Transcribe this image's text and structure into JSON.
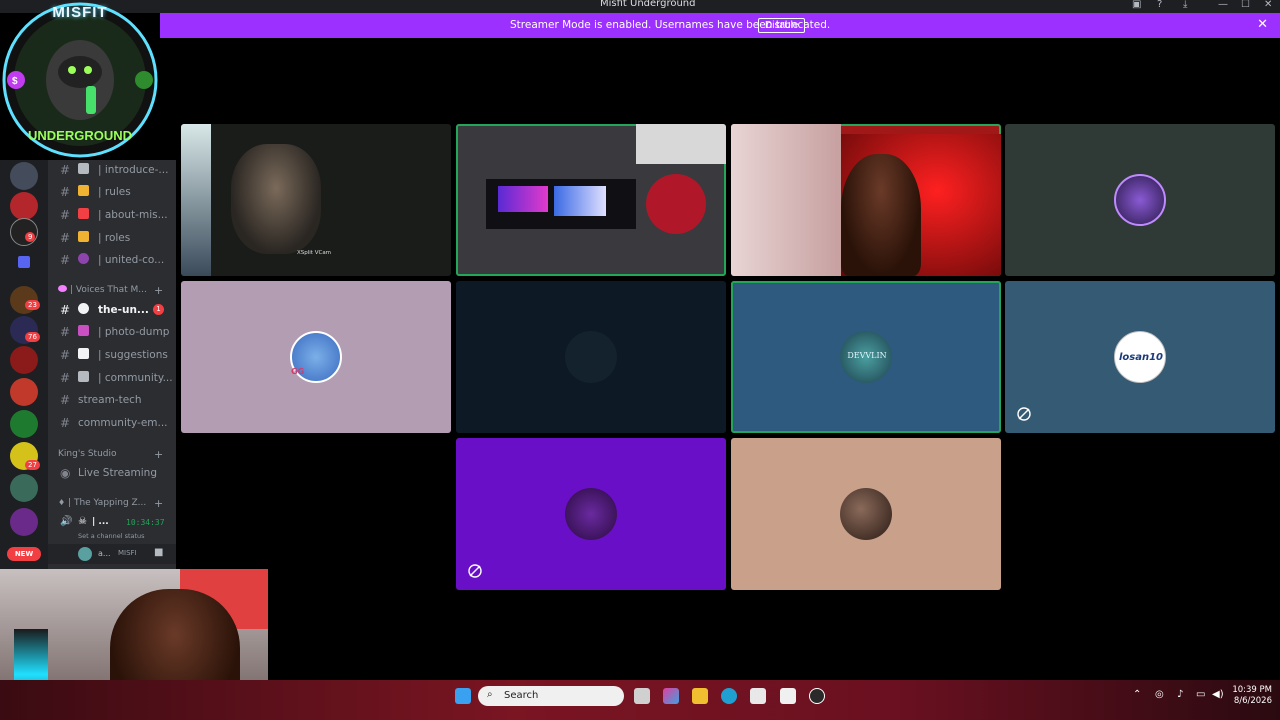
{
  "window": {
    "title": "Misfit Underground",
    "controls": [
      "—",
      "☐",
      "✕"
    ]
  },
  "banner": {
    "message": "Streamer Mode is enabled. Usernames have been truncated.",
    "disable_label": "Disable",
    "close_label": "✕"
  },
  "logo": {
    "line1": "MISFIT",
    "line2": "UNDERGROUND"
  },
  "servers": {
    "badges": [
      "9",
      "23",
      "76",
      "27",
      "NEW"
    ]
  },
  "channels": {
    "items": [
      {
        "label": "| introduce-...",
        "emoji_color": "#b5bac1"
      },
      {
        "label": "| rules",
        "emoji_color": "#f0b232"
      },
      {
        "label": "| about-mis...",
        "emoji_color": "#f23f43"
      },
      {
        "label": "| roles",
        "emoji_color": "#f0b232"
      },
      {
        "label": "| united-co...",
        "emoji_color": "#8e44ad"
      }
    ],
    "category_voices": "| Voices That M...",
    "voices_items": [
      {
        "label": "the-un...",
        "emoji_color": "#f2f3f5",
        "badge": "1"
      },
      {
        "label": "| photo-dump",
        "emoji_color": "#c850c0"
      },
      {
        "label": "| suggestions",
        "emoji_color": "#f2f3f5"
      },
      {
        "label": "| community...",
        "emoji_color": "#b5bac1"
      },
      {
        "label": "stream-tech",
        "emoji_color": ""
      },
      {
        "label": "community-em...",
        "emoji_color": ""
      }
    ],
    "category_kings": "King's Studio",
    "live_streaming": "Live Streaming",
    "category_yapping": "| The Yapping Z...",
    "voice_user": "| ...",
    "voice_timer": "10:34:37",
    "voice_status": "Set a channel status",
    "userbar_name": "a...",
    "userbar_tag": "MISFI"
  },
  "tiles": [
    {
      "name": "tile-1",
      "bg": "#1a1c1a",
      "speaking": false,
      "type": "video",
      "caption": "XSplit VCam"
    },
    {
      "name": "tile-2",
      "bg": "#2a2a2e",
      "speaking": true,
      "type": "video"
    },
    {
      "name": "tile-3",
      "bg": "#a01818",
      "speaking": true,
      "type": "video"
    },
    {
      "name": "tile-4",
      "bg": "#2f3a36",
      "speaking": false,
      "type": "avatar",
      "avatar_color": "#5b3a9a"
    },
    {
      "name": "tile-5",
      "bg": "#b39db3",
      "speaking": false,
      "type": "avatar",
      "avatar_color": "#6fa3d8",
      "avatar_text": "GG"
    },
    {
      "name": "tile-6",
      "bg": "#0d1a26",
      "speaking": false,
      "type": "avatar",
      "avatar_color": "#14222e"
    },
    {
      "name": "tile-7",
      "bg": "#2e5a80",
      "speaking": true,
      "type": "avatar",
      "avatar_color": "#1d3f4d",
      "avatar_text": "DEVVLIN"
    },
    {
      "name": "tile-8",
      "bg": "#345a74",
      "speaking": false,
      "type": "avatar",
      "avatar_color": "#ffffff",
      "avatar_text": "losan10",
      "muted": true
    },
    {
      "name": "tile-9",
      "bg": "#6a0fc8",
      "speaking": false,
      "type": "avatar",
      "avatar_color": "#3a1560",
      "muted": true
    },
    {
      "name": "tile-10",
      "bg": "#c9a08a",
      "speaking": false,
      "type": "avatar",
      "avatar_color": "#3a2a24"
    }
  ],
  "taskbar": {
    "search_label": "Search",
    "time": "10:39 PM",
    "date": "8/6/2026"
  }
}
